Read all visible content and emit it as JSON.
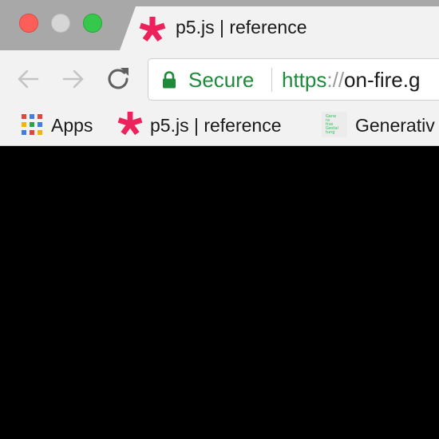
{
  "window": {
    "controls": [
      "close",
      "minimize",
      "zoom"
    ],
    "colors": {
      "close": "#fc5f57",
      "minimize": "#d6d6d6",
      "zoom": "#35c84a",
      "content_background": "#000000",
      "secure_green": "#1e8a3a",
      "p5_favicon": "#ed225d"
    }
  },
  "tab": {
    "title": "p5.js | reference",
    "favicon": "p5-asterisk-icon"
  },
  "toolbar": {
    "back_icon": "arrow-left-icon",
    "forward_icon": "arrow-right-icon",
    "reload_icon": "reload-icon"
  },
  "omnibox": {
    "secure_label": "Secure",
    "url_scheme": "https",
    "url_separator": "://",
    "url_host": "on-fire.g"
  },
  "bookmarks": [
    {
      "label": "Apps",
      "icon": "apps-grid-icon"
    },
    {
      "label": "p5.js | reference",
      "icon": "p5-asterisk-icon"
    },
    {
      "label": "Generativ",
      "icon": "generative-gestaltung-icon",
      "icon_text": [
        "Gene",
        "ra",
        "tive",
        "Gestal",
        "tung"
      ]
    }
  ]
}
